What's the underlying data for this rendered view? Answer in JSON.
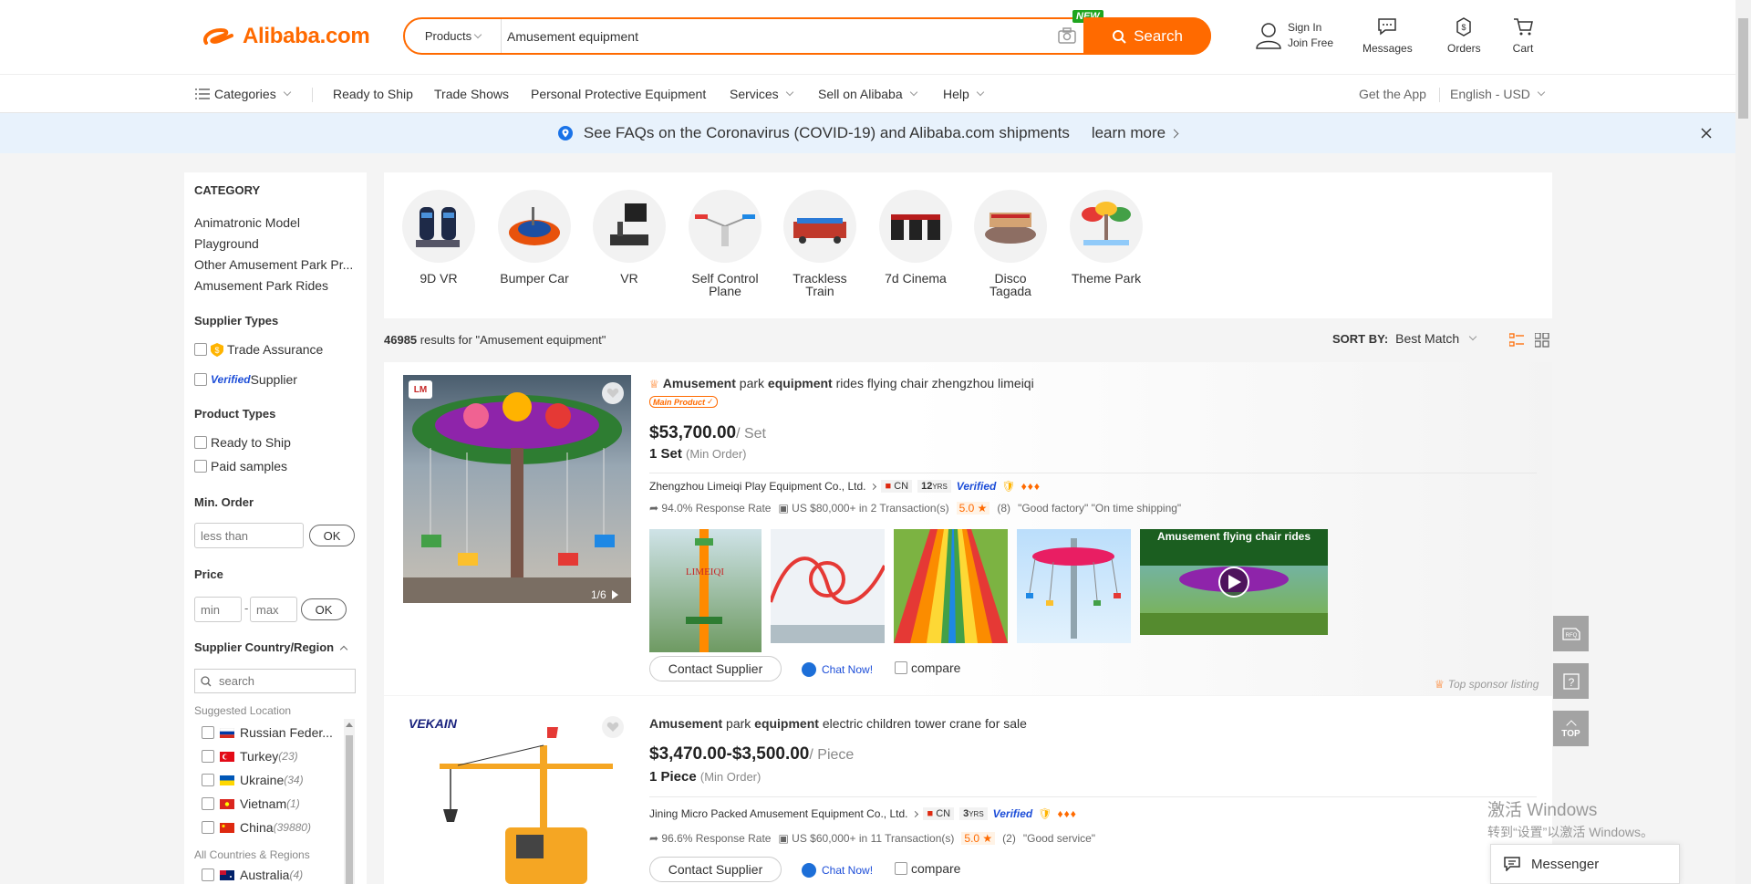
{
  "header": {
    "logo_text": "Alibaba.com",
    "search_category": "Products",
    "search_value": "Amusement equipment",
    "new_tag": "NEW",
    "search_button": "Search",
    "sign_in": "Sign In",
    "join_free": "Join Free",
    "messages": "Messages",
    "orders": "Orders",
    "cart": "Cart"
  },
  "nav": {
    "categories": "Categories",
    "items": [
      "Ready to Ship",
      "Trade Shows",
      "Personal Protective Equipment",
      "Services",
      "Sell on Alibaba",
      "Help"
    ],
    "get_app": "Get the App",
    "language": "English - USD"
  },
  "banner": {
    "text": "See FAQs on the Coronavirus (COVID-19) and Alibaba.com shipments",
    "link": "learn more"
  },
  "sidebar": {
    "category_title": "CATEGORY",
    "categories": [
      "Animatronic Model",
      "Playground",
      "Other Amusement Park Pr...",
      "Amusement Park Rides"
    ],
    "supplier_types_title": "Supplier Types",
    "trade_assurance": "Trade Assurance",
    "verified_prefix": "Verified",
    "verified_suffix": "Supplier",
    "product_types_title": "Product Types",
    "ready_to_ship": "Ready to Ship",
    "paid_samples": "Paid samples",
    "min_order_title": "Min. Order",
    "min_order_placeholder": "less than",
    "ok": "OK",
    "price_title": "Price",
    "price_min": "min",
    "price_max": "max",
    "country_title": "Supplier Country/Region",
    "country_search": "search",
    "suggested_location": "Suggested Location",
    "countries": [
      {
        "name": "Russian Feder...",
        "count": ""
      },
      {
        "name": "Turkey",
        "count": "(23)"
      },
      {
        "name": "Ukraine",
        "count": "(34)"
      },
      {
        "name": "Vietnam",
        "count": "(1)"
      },
      {
        "name": "China",
        "count": "(39880)"
      }
    ],
    "all_countries": "All Countries & Regions",
    "australia": {
      "name": "Australia",
      "count": "(4)"
    }
  },
  "related": [
    {
      "label": "9D VR"
    },
    {
      "label": "Bumper Car"
    },
    {
      "label": "VR"
    },
    {
      "label": "Self Control Plane"
    },
    {
      "label": "Trackless Train"
    },
    {
      "label": "7d Cinema"
    },
    {
      "label": "Disco Tagada"
    },
    {
      "label": "Theme Park"
    }
  ],
  "results": {
    "count": "46985",
    "query_text": "results for \"Amusement equipment\"",
    "sort_label": "SORT BY:",
    "sort_value": "Best Match"
  },
  "products": [
    {
      "title_bold1": "Amusement",
      "title_mid1": " park ",
      "title_bold2": "equipment",
      "title_rest": " rides flying chair zhengzhou limeiqi",
      "main_product": "Main Product",
      "price": "$53,700.00",
      "unit": "/ Set",
      "moq": "1 Set",
      "moq_label": "(Min Order)",
      "supplier": "Zhengzhou Limeiqi Play Equipment Co., Ltd.",
      "country": "CN",
      "years": "12",
      "years_unit": "YRS",
      "verified": "Verified",
      "response": "94.0% Response Rate",
      "transactions": "US $80,000+ in 2 Transaction(s)",
      "rating": "5.0",
      "reviews": "(8)",
      "tags": "\"Good factory\"  \"On time shipping\"",
      "gallery_counter": "1/6",
      "video_caption": "Amusement flying chair rides",
      "thumb_watermark": "LIMEIQI",
      "sponsor": "Top sponsor listing",
      "contact": "Contact Supplier",
      "chat": "Chat Now!",
      "compare": "compare"
    },
    {
      "title_bold1": "Amusement",
      "title_mid1": " park ",
      "title_bold2": "equipment",
      "title_rest": " electric children tower crane for sale",
      "price": "$3,470.00-$3,500.00",
      "unit": "/ Piece",
      "moq": "1 Piece",
      "moq_label": "(Min Order)",
      "supplier": "Jining Micro Packed Amusement Equipment Co., Ltd.",
      "country": "CN",
      "years": "3",
      "years_unit": "YRS",
      "verified": "Verified",
      "response": "96.6% Response Rate",
      "transactions": "US $60,000+ in 11 Transaction(s)",
      "rating": "5.0",
      "reviews": "(2)",
      "tags": "\"Good service\"",
      "brand_logo": "VEKAIN",
      "contact": "Contact Supplier",
      "chat": "Chat Now!",
      "compare": "compare"
    }
  ],
  "floating": {
    "rfq": "RFQ",
    "top": "TOP"
  },
  "messenger": "Messenger",
  "watermark": {
    "line1": "激活 Windows",
    "line2": "转到“设置”以激活 Windows。"
  },
  "colors": {
    "accent": "#ff6a00",
    "banner_bg": "#e8f2fc",
    "verified": "#1d4ed8"
  }
}
